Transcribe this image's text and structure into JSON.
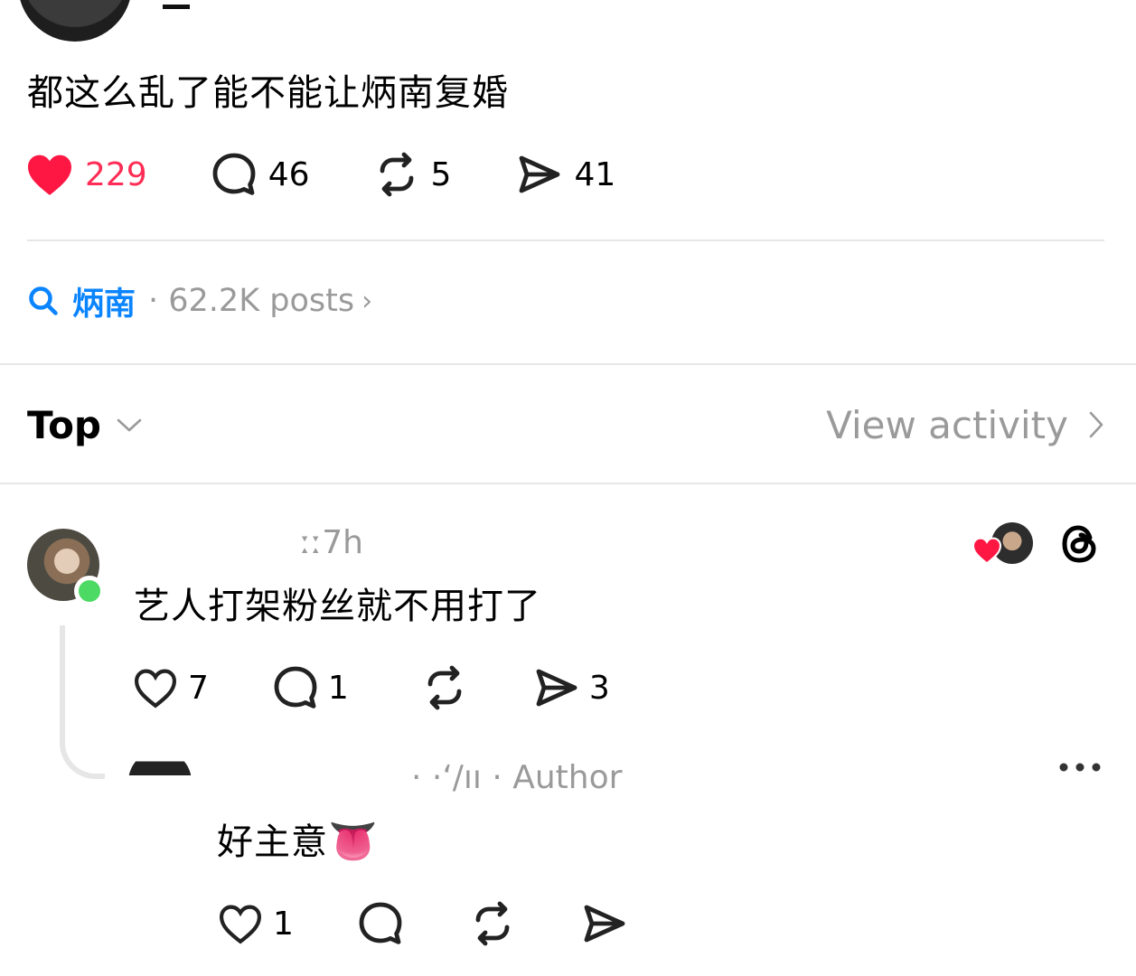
{
  "post": {
    "text": "都这么乱了能不能让炳南复婚",
    "actions": {
      "likes": "229",
      "comments": "46",
      "reposts": "5",
      "shares": "41"
    }
  },
  "topic_tag": {
    "name": "炳南",
    "meta": "· 62.2K posts",
    "chevron": "›"
  },
  "sort_bar": {
    "label": "Top",
    "view_activity": "View activity"
  },
  "comment": {
    "time": "ːː7h",
    "text": "艺人打架粉丝就不用打了",
    "actions": {
      "likes": "7",
      "comments": "1",
      "shares": "3"
    }
  },
  "reply": {
    "meta": "· ·ʻ/ıı · Author",
    "text": "好主意",
    "emoji": "👅",
    "actions": {
      "likes": "1"
    }
  },
  "colors": {
    "like_red": "#ff2d55",
    "link_blue": "#0a84ff",
    "muted_gray": "#9a9a9a",
    "online_green": "#4cd964"
  }
}
